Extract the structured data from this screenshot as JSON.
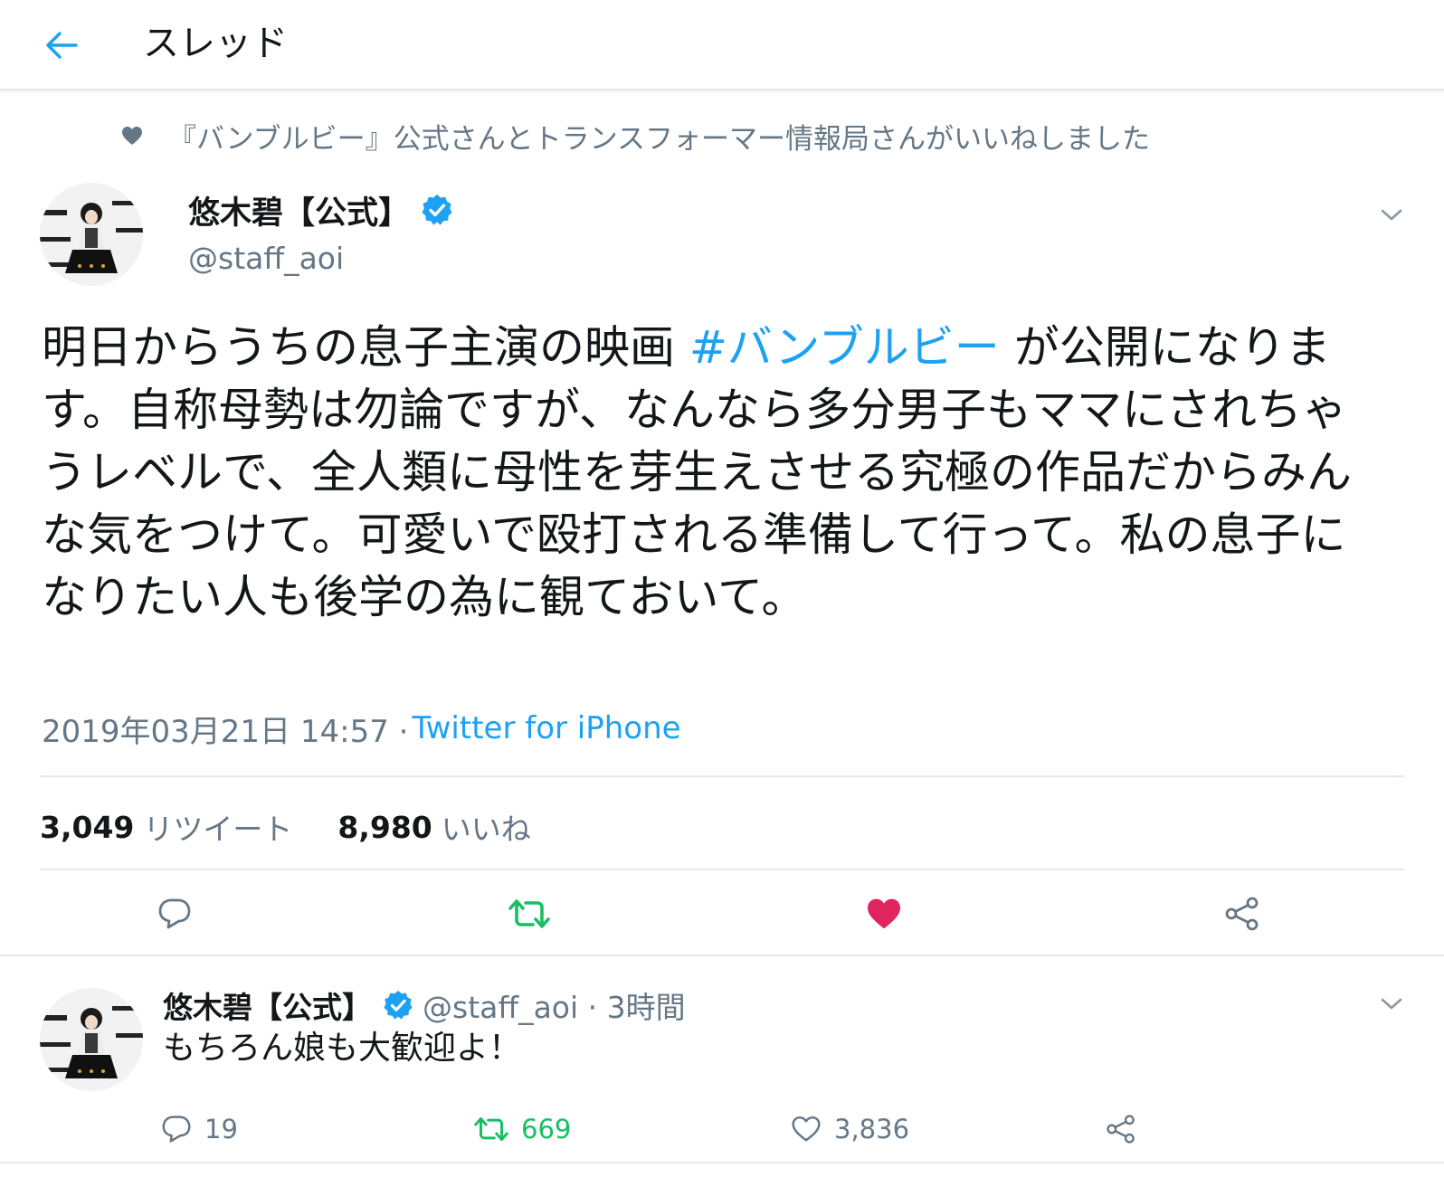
{
  "header": {
    "title": "スレッド"
  },
  "social_context": "『バンブルビー』公式さんとトランスフォーマー情報局さんがいいねしました",
  "main_tweet": {
    "display_name": "悠木碧【公式】",
    "handle": "@staff_aoi",
    "text_before": "明日からうちの息子主演の映画 ",
    "hashtag": "#バンブルビー",
    "text_after": " が公開になります。自称母勢は勿論ですが、なんなら多分男子もママにされちゃうレベルで、全人類に母性を芽生えさせる究極の作品だからみんな気をつけて。可愛いで殴打される準備して行って。私の息子になりたい人も後学の為に観ておいて。",
    "timestamp": "2019年03月21日 14:57 · ",
    "source": "Twitter for iPhone",
    "retweet_count": "3,049",
    "retweet_label": "リツイート",
    "like_count": "8,980",
    "like_label": "いいね",
    "liked": true
  },
  "reply_tweet": {
    "display_name": "悠木碧【公式】",
    "handle_time": "@staff_aoi · 3時間",
    "text": "もちろん娘も大歓迎よ！",
    "reply_count": "19",
    "retweet_count": "669",
    "like_count": "3,836",
    "retweeted": true
  },
  "colors": {
    "accent": "#1da1f2",
    "retweet_green": "#17bf63",
    "like_red": "#e0245e",
    "muted": "#657786"
  },
  "icons": [
    "back-arrow-icon",
    "heart-icon",
    "verified-badge-icon",
    "chevron-down-icon",
    "reply-icon",
    "retweet-icon",
    "share-icon"
  ]
}
